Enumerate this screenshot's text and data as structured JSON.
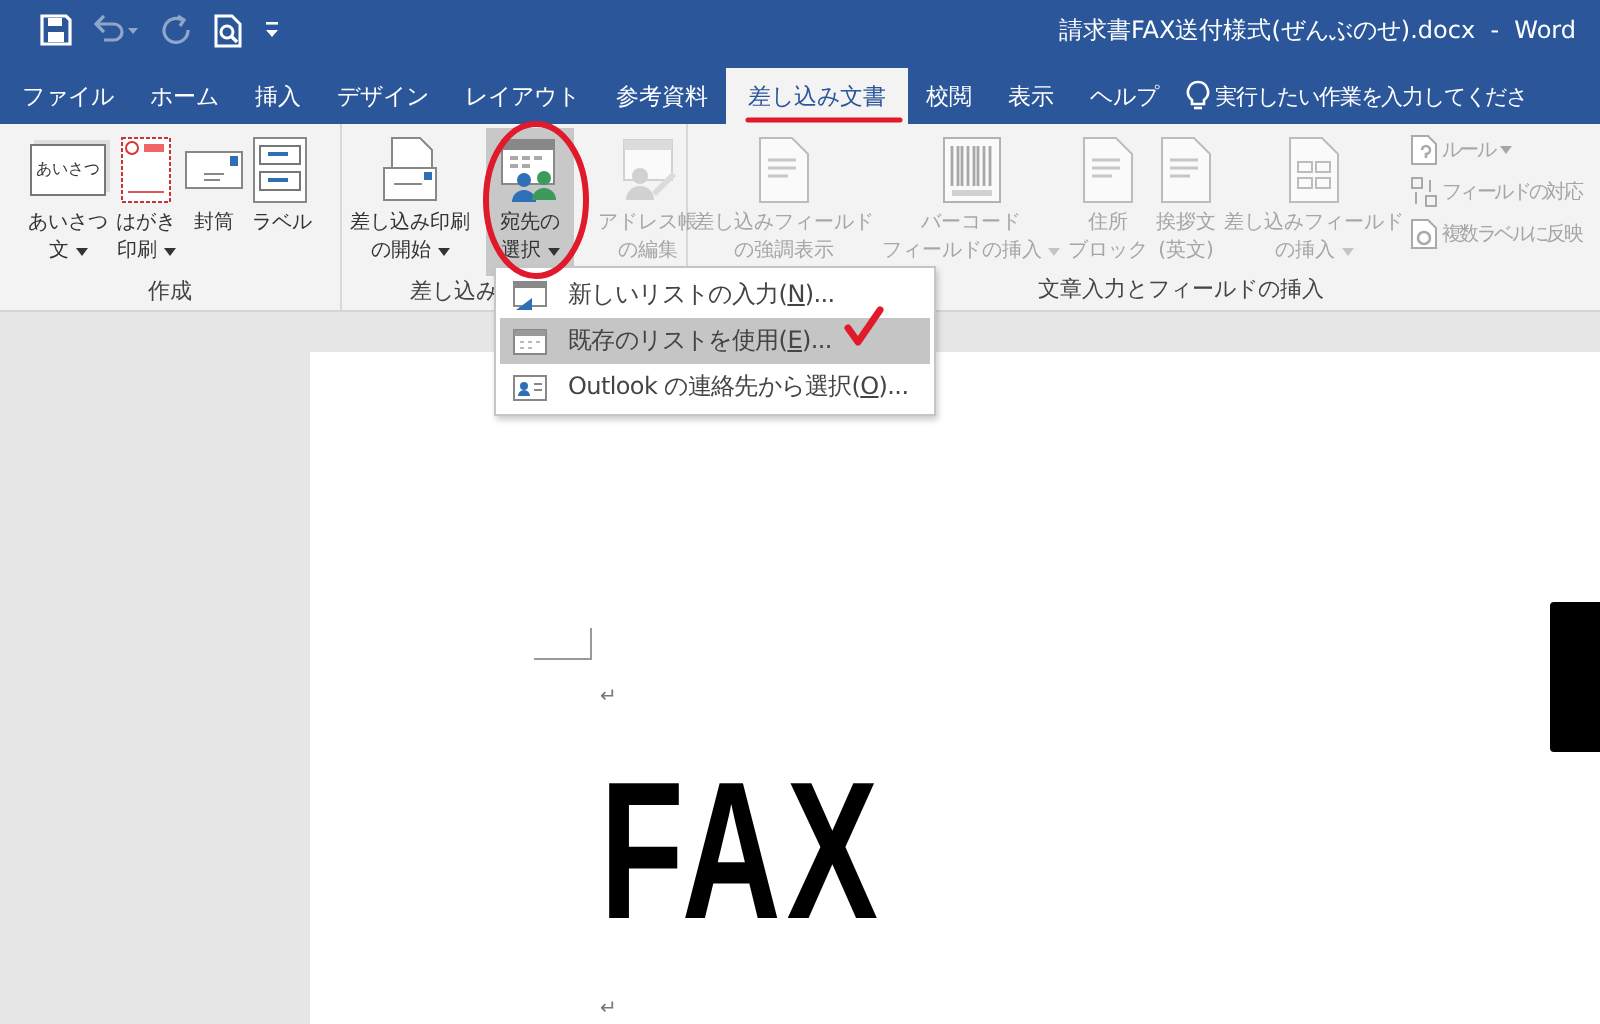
{
  "title_bar": {
    "quick_access": [
      {
        "disabled": false
      },
      {
        "disabled": true
      },
      {
        "disabled": true
      },
      {
        "disabled": false
      },
      {
        "disabled": false
      }
    ],
    "title": "請求書FAX送付様式(ぜんぶのせ).docx  -  Word"
  },
  "tabs": [
    {
      "label": "ファイル",
      "selected": false
    },
    {
      "label": "ホーム",
      "selected": false
    },
    {
      "label": "挿入",
      "selected": false
    },
    {
      "label": "デザイン",
      "selected": false
    },
    {
      "label": "レイアウト",
      "selected": false
    },
    {
      "label": "参考資料",
      "selected": false
    },
    {
      "label": "差し込み文書",
      "selected": true
    },
    {
      "label": "校閲",
      "selected": false
    },
    {
      "label": "表示",
      "selected": false
    },
    {
      "label": "ヘルプ",
      "selected": false
    }
  ],
  "tell_me": {
    "placeholder": "実行したい作業を入力してくださ"
  },
  "ribbon": {
    "groups": [
      {
        "label": "作成",
        "buttons": [
          {
            "kind": "large",
            "icon_text": "あいさつ",
            "lines": [
              "あいさつ",
              "文"
            ],
            "dropdown": true,
            "disabled": false
          },
          {
            "kind": "large",
            "lines": [
              "はがき",
              "印刷"
            ],
            "dropdown": true,
            "disabled": false
          },
          {
            "kind": "large",
            "lines": [
              "封筒"
            ],
            "dropdown": false,
            "disabled": false
          },
          {
            "kind": "large",
            "lines": [
              "ラベル"
            ],
            "dropdown": false,
            "disabled": false
          }
        ]
      },
      {
        "label": "差し込み",
        "buttons": [
          {
            "kind": "large",
            "lines": [
              "差し込み印刷",
              "の開始"
            ],
            "dropdown": true,
            "disabled": false
          },
          {
            "kind": "large",
            "lines": [
              "宛先の",
              "選択"
            ],
            "dropdown": true,
            "disabled": false,
            "pressed": true
          },
          {
            "kind": "large",
            "lines": [
              "アドレス帳",
              "の編集"
            ],
            "dropdown": false,
            "disabled": true
          }
        ]
      },
      {
        "label": "文章入力とフィールドの挿入",
        "buttons": [
          {
            "kind": "large",
            "lines": [
              "差し込みフィールド",
              "の強調表示"
            ],
            "dropdown": false,
            "disabled": true
          },
          {
            "kind": "large",
            "lines": [
              "バーコード",
              "フィールドの挿入"
            ],
            "dropdown": true,
            "disabled": true
          },
          {
            "kind": "large",
            "lines": [
              "住所",
              "ブロック"
            ],
            "dropdown": false,
            "disabled": true
          },
          {
            "kind": "large",
            "lines": [
              "挨拶文",
              "(英文)"
            ],
            "dropdown": false,
            "disabled": true
          },
          {
            "kind": "large",
            "lines": [
              "差し込みフィールド",
              "の挿入"
            ],
            "dropdown": true,
            "disabled": true
          },
          {
            "kind": "small",
            "lines": [
              "ルール"
            ],
            "dropdown": true,
            "disabled": true
          },
          {
            "kind": "small",
            "lines": [
              "フィールドの対応"
            ],
            "dropdown": false,
            "disabled": true
          },
          {
            "kind": "small",
            "lines": [
              "複数ラベルに反映"
            ],
            "dropdown": false,
            "disabled": true
          }
        ]
      }
    ]
  },
  "dropdown_menu": {
    "items": [
      {
        "label_before": "新しいリストの入力(",
        "access_key": "N",
        "label_after": ")...",
        "selected": false
      },
      {
        "label_before": "既存のリストを使用(",
        "access_key": "E",
        "label_after": ")...",
        "selected": true
      },
      {
        "label_before": "Outlook の連絡先から選択(",
        "access_key": "O",
        "label_after": ")...",
        "selected": false
      }
    ]
  },
  "document": {
    "paragraphs": [
      {
        "kind": "mark",
        "text": "↵"
      },
      {
        "kind": "heading",
        "text": "FAX"
      },
      {
        "kind": "mark",
        "text": "↵"
      }
    ]
  }
}
